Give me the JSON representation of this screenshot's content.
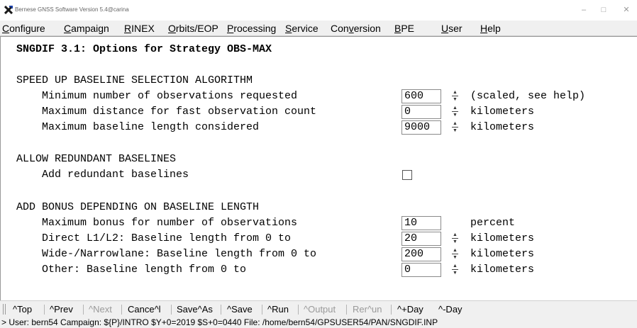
{
  "window": {
    "title": "Bernese GNSS Software Version 5.4@carina",
    "minimize": "–",
    "maximize": "□",
    "close": "✕"
  },
  "menu": [
    {
      "label": "Configure"
    },
    {
      "label": "Campaign"
    },
    {
      "label": "RINEX"
    },
    {
      "label": "Orbits/EOP"
    },
    {
      "label": "Processing"
    },
    {
      "label": "Service"
    },
    {
      "label": "Conversion"
    },
    {
      "label": "BPE"
    },
    {
      "label": "User"
    },
    {
      "label": "Help"
    }
  ],
  "panel": {
    "title": "SNGDIF 3.1: Options for Strategy OBS-MAX",
    "sections": {
      "speed_up": {
        "heading": "SPEED UP BASELINE SELECTION ALGORITHM",
        "rows": [
          {
            "label": "Minimum number of observations requested",
            "value": "600",
            "unit": "(scaled, see help)"
          },
          {
            "label": "Maximum distance for fast observation count",
            "value": "0",
            "unit": "kilometers"
          },
          {
            "label": "Maximum baseline length considered",
            "value": "9000",
            "unit": "kilometers"
          }
        ]
      },
      "redundant": {
        "heading": "ALLOW REDUNDANT BASELINES",
        "label": "Add redundant baselines",
        "checked": false
      },
      "bonus": {
        "heading": "ADD BONUS DEPENDING ON BASELINE LENGTH",
        "rows": [
          {
            "label": "Maximum bonus for number of observations",
            "value": "10",
            "unit": "percent"
          },
          {
            "label": "Direct L1/L2: Baseline length from 0 to",
            "value": "20",
            "unit": "kilometers"
          },
          {
            "label": "Wide-/Narrowlane: Baseline length from 0 to",
            "value": "200",
            "unit": "kilometers"
          },
          {
            "label": "Other: Baseline length from 0 to",
            "value": "0",
            "unit": "kilometers"
          }
        ]
      }
    }
  },
  "toolbar": {
    "top": "^Top",
    "prev": "^Prev",
    "next": "^Next",
    "cancel": "Cance^l",
    "save_as": "Save^As",
    "save": "^Save",
    "run": "^Run",
    "output": "^Output",
    "rerun": "Rer^un",
    "plus_day": "^+Day",
    "minus_day": "^-Day"
  },
  "status": {
    "text": "> User: bern54  Campaign: ${P}/INTRO  $Y+0=2019  $S+0=0440  File: /home/bern54/GPSUSER54/PAN/SNGDIF.INP"
  }
}
